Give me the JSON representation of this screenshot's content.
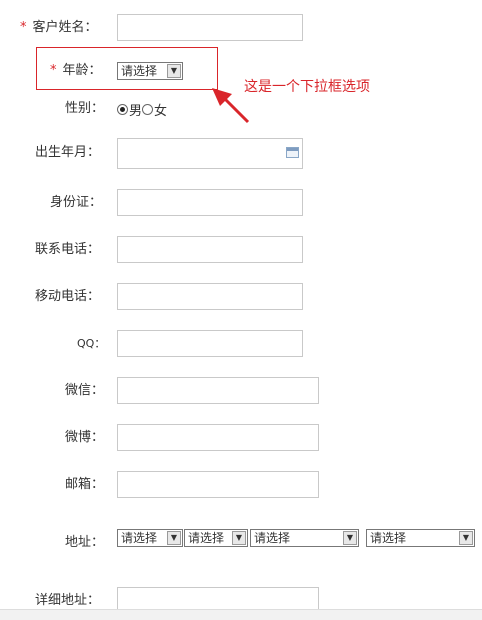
{
  "form": {
    "customer_name": {
      "label": "客户姓名：",
      "required_mark": "*"
    },
    "age": {
      "label": "年龄：",
      "required_mark": "*",
      "select": "请选择"
    },
    "gender": {
      "label": "性别：",
      "options": [
        "男",
        "女"
      ],
      "selected": "男"
    },
    "birth": {
      "label": "出生年月："
    },
    "id_card": {
      "label": "身份证："
    },
    "phone": {
      "label": "联系电话："
    },
    "mobile": {
      "label": "移动电话："
    },
    "qq": {
      "label": "QQ："
    },
    "wechat": {
      "label": "微信："
    },
    "weibo": {
      "label": "微博："
    },
    "email": {
      "label": "邮箱："
    },
    "address": {
      "label": "地址：",
      "selects": [
        "请选择",
        "请选择",
        "请选择",
        "请选择"
      ]
    },
    "detail_address": {
      "label": "详细地址："
    }
  },
  "annotation": {
    "text": "这是一个下拉框选项"
  },
  "colors": {
    "accent": "#d9252a",
    "border": "#c9c9c9"
  },
  "icons": {
    "arrow": "arrow-icon",
    "calendar": "calendar-icon",
    "dropdown": "chevron-down-icon"
  }
}
